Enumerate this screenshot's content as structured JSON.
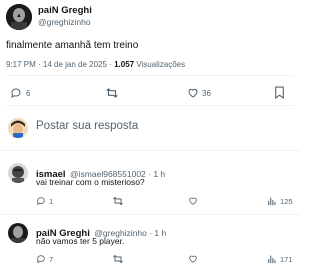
{
  "tweet": {
    "display_name": "paiN Greghi",
    "handle": "@greghizinho",
    "text": "finalmente amanhã tem treino",
    "time": "9:17 PM · 14 de jan de 2025 · ",
    "views_count": "1.057",
    "views_label": " Visualizações",
    "actions": {
      "replies": "6",
      "likes": "36"
    }
  },
  "composer": {
    "placeholder": "Postar sua resposta"
  },
  "replies": [
    {
      "display_name": "ismael",
      "handle": "@ismael968551002 · 1 h",
      "text": "vai treinar com o misterioso?",
      "reply_count": "1",
      "views": "125"
    },
    {
      "display_name": "paiN Greghi",
      "handle": "@greghizinho · 1 h",
      "text": "não vamos ter 5 player.",
      "reply_count": "7",
      "views": "171"
    }
  ],
  "colors": {
    "accent": "#1d9bf0",
    "text": "#0f1419",
    "muted": "#536471",
    "border": "#eff3f4"
  },
  "icons": [
    "reply-icon",
    "retweet-icon",
    "like-icon",
    "bookmark-icon",
    "views-icon",
    "share-icon"
  ]
}
